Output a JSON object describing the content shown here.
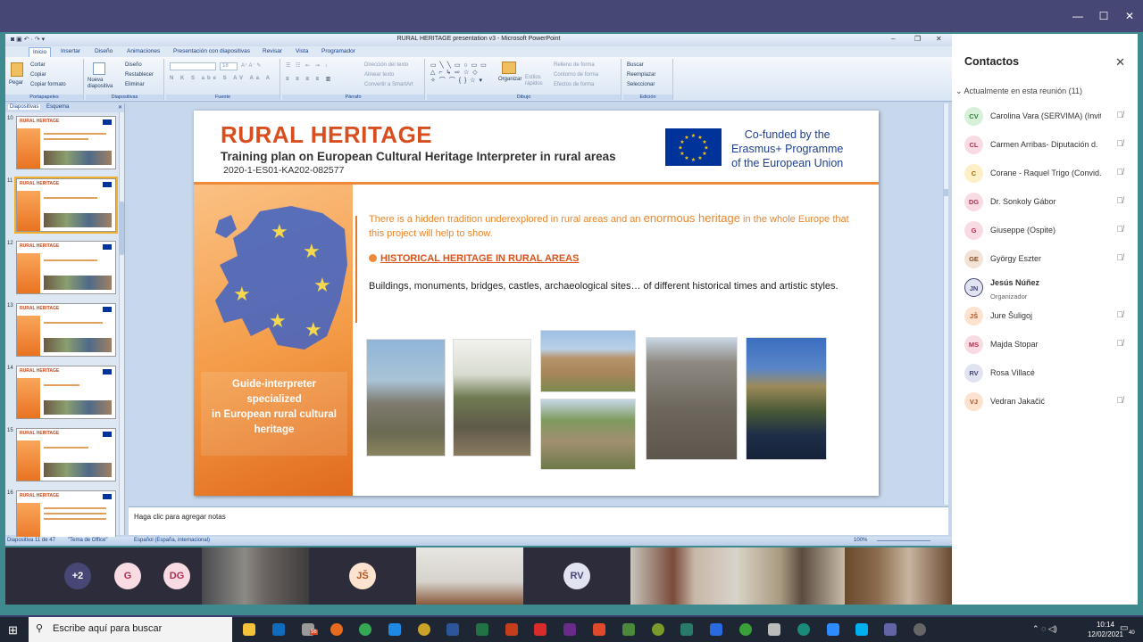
{
  "teams": {
    "minimize": "—",
    "maximize": "☐",
    "close": "✕"
  },
  "ppt": {
    "window_title": "RURAL HERITAGE presentation v3 - Microsoft PowerPoint",
    "tabs": [
      "Inicio",
      "Insertar",
      "Diseño",
      "Animaciones",
      "Presentación con diapositivas",
      "Revisar",
      "Vista",
      "Programador"
    ],
    "ribbon": {
      "paste": "Pegar",
      "cut": "Cortar",
      "copy": "Copiar",
      "copy_format": "Copiar formato",
      "new_slide": "Nueva diapositiva",
      "layout": "Diseño",
      "reset": "Restablecer",
      "delete": "Eliminar",
      "arrange": "Organizar",
      "quick_styles": "Estilos rápidos",
      "shape_fill": "Relleno de forma",
      "shape_outline": "Contorno de forma",
      "shape_effects": "Efectos de forma",
      "find": "Buscar",
      "replace": "Reemplazar",
      "select": "Seleccionar",
      "text_direction": "Dirección del texto",
      "align_text": "Alinear texto",
      "smartart": "Convertir a SmartArt",
      "font_size": "18",
      "groups": {
        "clipboard": "Portapapeles",
        "slides": "Diapositivas",
        "font": "Fuente",
        "paragraph": "Párrafo",
        "drawing": "Dibujo",
        "editing": "Edición"
      }
    },
    "panel_tabs": {
      "slides": "Diapositivas",
      "outline": "Esquema"
    },
    "thumbs": [
      {
        "n": "11"
      },
      {
        "n": "12"
      },
      {
        "n": "13"
      },
      {
        "n": "14"
      },
      {
        "n": "15"
      },
      {
        "n": "16"
      }
    ],
    "thumb_title": "RURAL HERITAGE",
    "notes_placeholder": "Haga clic para agregar notas",
    "status": {
      "slide": "Diapositiva 11 de 47",
      "theme": "\"Tema de Office\"",
      "language": "Español (España, internacional)",
      "zoom": "100%"
    }
  },
  "slide": {
    "title": "RURAL HERITAGE",
    "subtitle": "Training plan on European Cultural Heritage Interpreter in rural areas",
    "code": "2020-1-ES01-KA202-082577",
    "eu_line1": "Co-funded by the",
    "eu_line2": "Erasmus+ Programme",
    "eu_line3": "of the European Union",
    "guide_line1": "Guide-interpreter",
    "guide_line2": "specialized",
    "guide_line3": "in European rural cultural",
    "guide_line4": "heritage",
    "p1_a": "There is a hidden tradition underexplored in rural areas and an ",
    "p1_b": "enormous heritage",
    "p1_c": " in the whole Europe that this project will help to show.",
    "heading": "HISTORICAL HERITAGE IN RURAL AREAS",
    "p2": "Buildings, monuments, bridges, castles, archaeological sites… of different historical times and artistic styles."
  },
  "contacts": {
    "title": "Contactos",
    "section": "Actualmente en esta reunión (11)",
    "people": [
      {
        "initials": "CV",
        "name": "Carolina Vara (SERVIMA) (Invit.",
        "bg": "#d6f0da",
        "fg": "#2e7d32"
      },
      {
        "initials": "CL",
        "name": "Carmen Arribas- Diputación d.",
        "bg": "#f9dce3",
        "fg": "#b0304f"
      },
      {
        "initials": "C",
        "name": "Corane - Raquel Trigo (Convid.",
        "bg": "#fdf0c8",
        "fg": "#9a6b00"
      },
      {
        "initials": "DG",
        "name": "Dr. Sonkoly Gábor",
        "bg": "#f9dce3",
        "fg": "#b0304f"
      },
      {
        "initials": "G",
        "name": "Giuseppe (Ospite)",
        "bg": "#f9dce3",
        "fg": "#b0304f"
      },
      {
        "initials": "GE",
        "name": "György Eszter",
        "bg": "#f3e2d6",
        "fg": "#8a4a1d"
      },
      {
        "initials": "JN",
        "name": "Jesús Núñez",
        "role": "Organizador",
        "bg": "#e2e3f1",
        "fg": "#464775"
      },
      {
        "initials": "JŠ",
        "name": "Jure Šuligoj",
        "bg": "#fde3cf",
        "fg": "#b5541c"
      },
      {
        "initials": "MS",
        "name": "Majda Stopar",
        "bg": "#f9dce3",
        "fg": "#b0304f"
      },
      {
        "initials": "RV",
        "name": "Rosa Villacé",
        "bg": "#e2e3f1",
        "fg": "#464775"
      },
      {
        "initials": "VJ",
        "name": "Vedran Jakačić",
        "bg": "#fde3cf",
        "fg": "#b5541c"
      }
    ],
    "close": "✕"
  },
  "video": {
    "more": "+2",
    "g": "G",
    "dg": "DG",
    "js": "JŠ",
    "rv": "RV"
  },
  "taskbar": {
    "search_placeholder": "Escribe aquí para buscar",
    "time": "10:14",
    "date": "12/02/2021",
    "badge": "56",
    "notif": "40"
  }
}
